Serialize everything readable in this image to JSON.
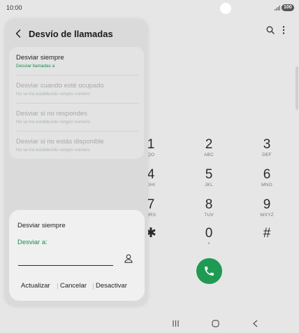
{
  "status_bar": {
    "time": "10:00",
    "battery": "100"
  },
  "dialer": {
    "keys": [
      {
        "digit": "1",
        "letters": "QO"
      },
      {
        "digit": "2",
        "letters": "ABC"
      },
      {
        "digit": "3",
        "letters": "DEF"
      },
      {
        "digit": "4",
        "letters": "GHI"
      },
      {
        "digit": "5",
        "letters": "JKL"
      },
      {
        "digit": "6",
        "letters": "MNO"
      },
      {
        "digit": "7",
        "letters": "QRS"
      },
      {
        "digit": "8",
        "letters": "TUV"
      },
      {
        "digit": "9",
        "letters": "WXYZ"
      },
      {
        "digit": "✱",
        "letters": ""
      },
      {
        "digit": "0",
        "letters": "+"
      },
      {
        "digit": "#",
        "letters": ""
      }
    ]
  },
  "settings": {
    "title": "Desvío de llamadas",
    "items": [
      {
        "title": "Desviar siempre",
        "subtitle": "Desviar llamadas a"
      },
      {
        "title": "Desviar cuando esté ocupado",
        "subtitle": "No se ha establecido ningún número"
      },
      {
        "title": "Desviar si no respondes",
        "subtitle": "No se ha establecido ningún número"
      },
      {
        "title": "Desviar si no estás disponible",
        "subtitle": "No se ha establecido ningún número"
      }
    ]
  },
  "dialog": {
    "title": "Desviar siempre",
    "field_label": "Desviar a:",
    "input_value": "",
    "actions": {
      "update": "Actualizar",
      "cancel": "Cancelar",
      "deactivate": "Desactivar"
    }
  },
  "colors": {
    "accent_green": "#1a8a4c",
    "call_green": "#1f9a52"
  }
}
